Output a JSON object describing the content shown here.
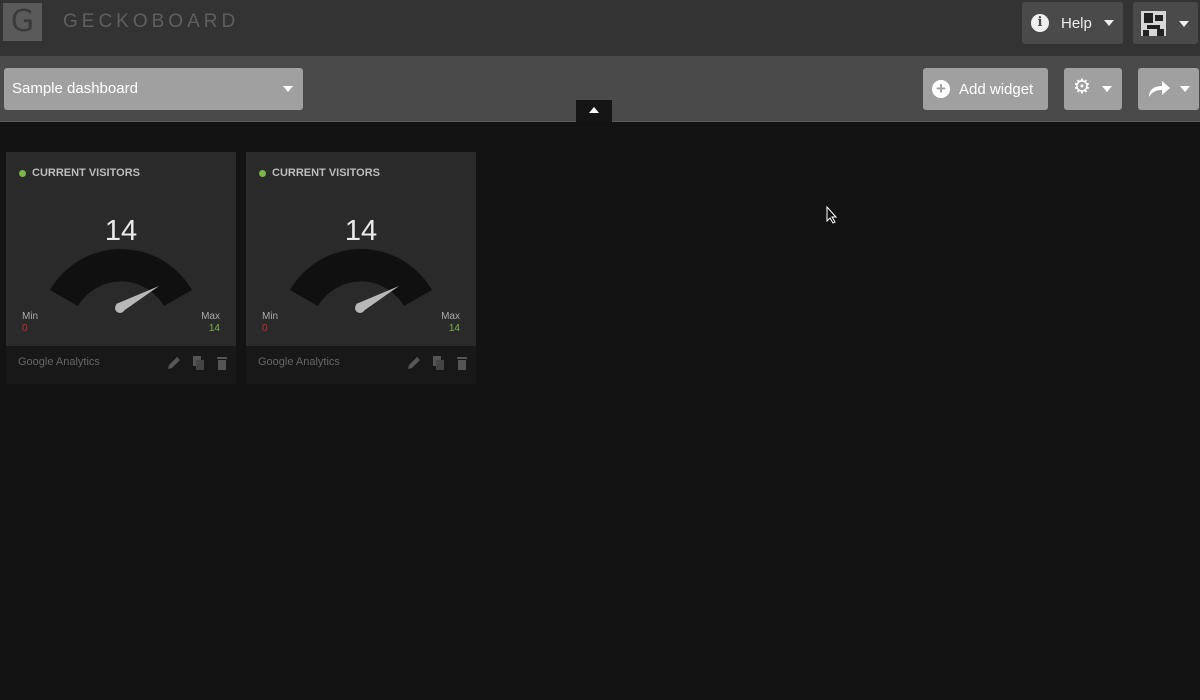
{
  "app": {
    "logo_letter": "G",
    "name": "GECKOBOARD"
  },
  "header": {
    "help_label": "Help"
  },
  "toolbar": {
    "dashboard_name": "Sample dashboard",
    "add_widget_label": "Add widget"
  },
  "widgets": [
    {
      "title": "CURRENT VISITORS",
      "value": "14",
      "min_label": "Min",
      "min_value": "0",
      "max_label": "Max",
      "max_value": "14",
      "source": "Google Analytics",
      "gauge_fraction": 1.0
    },
    {
      "title": "CURRENT VISITORS",
      "value": "14",
      "min_label": "Min",
      "min_value": "0",
      "max_label": "Max",
      "max_value": "14",
      "source": "Google Analytics",
      "gauge_fraction": 1.0
    }
  ],
  "colors": {
    "status_dot": "#79b84a",
    "min_value": "#c4322e",
    "max_value": "#79b84a",
    "button_bg": "#a0a0a0"
  },
  "icons": [
    "info-icon",
    "chevron-down-icon",
    "avatar",
    "plus-circle-icon",
    "gear-icon",
    "share-arrow-icon",
    "chevron-up-icon",
    "pencil-icon",
    "copy-icon",
    "trash-icon",
    "mouse-cursor"
  ]
}
